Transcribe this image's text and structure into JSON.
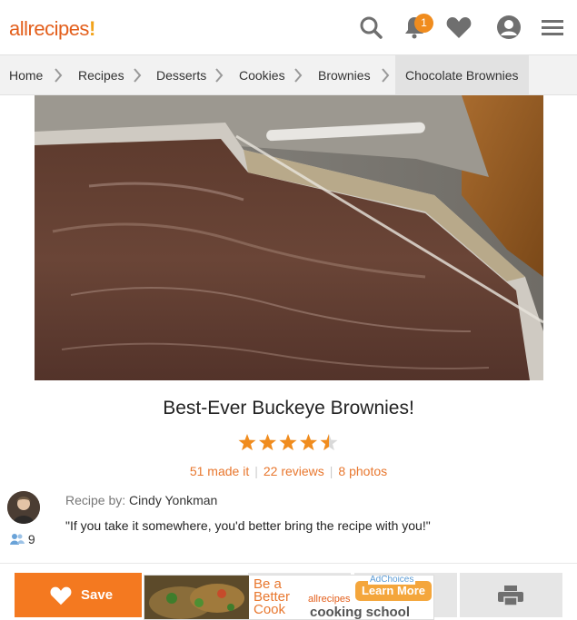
{
  "header": {
    "logo_text": "allrecipes",
    "logo_mark": "!",
    "notification_count": "1",
    "icons": [
      "search-icon",
      "bell-icon",
      "heart-icon",
      "user-icon",
      "menu-icon"
    ]
  },
  "breadcrumb": {
    "items": [
      "Home",
      "Recipes",
      "Desserts",
      "Cookies",
      "Brownies",
      "Chocolate Brownies"
    ]
  },
  "recipe": {
    "title": "Best-Ever Buckeye Brownies!",
    "rating": 4.5,
    "rating_max": 5,
    "made_it": "51 made it",
    "reviews": "22 reviews",
    "photos": "8 photos",
    "separator": "|",
    "author_label": "Recipe by:",
    "author_name": "Cindy Yonkman",
    "quote": "\"If you take it somewhere, you'd better bring the recipe with you!\"",
    "followers": "9"
  },
  "actions": {
    "save_label": "Save"
  },
  "ad": {
    "tagline": "Be a Better Cook",
    "brand": "allrecipes",
    "cta": "Learn More",
    "school": "cooking school",
    "adchoices": "AdChoices"
  },
  "colors": {
    "brand_orange": "#f47920",
    "logo_orange": "#e35f1c",
    "star_orange": "#f08c1e",
    "breadcrumb_bg": "#f2f2f2"
  }
}
